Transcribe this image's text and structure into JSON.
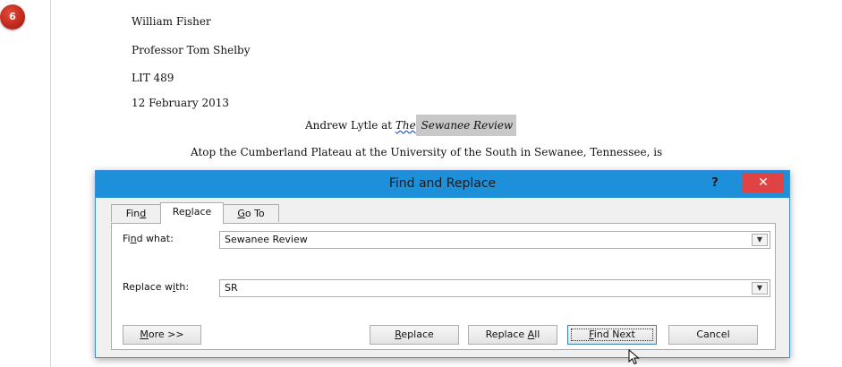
{
  "step_badge": "6",
  "document": {
    "lines": [
      "William Fisher",
      "Professor Tom Shelby",
      "LIT 489",
      "12 February 2013"
    ],
    "title_prefix": "Andrew Lytle at ",
    "title_the": "The",
    "title_highlight": " Sewanee Review",
    "paragraph": "Atop the Cumberland Plateau at the University of the South in Sewanee, Tennessee, is"
  },
  "dialog": {
    "title": "Find and Replace",
    "help": "?",
    "close": "✕",
    "tabs": {
      "find": {
        "pre": "Fin",
        "acc": "d",
        "post": ""
      },
      "replace": {
        "pre": "Re",
        "acc": "p",
        "post": "lace"
      },
      "goto": {
        "pre": "",
        "acc": "G",
        "post": "o To"
      },
      "active": "Replace"
    },
    "find_what": {
      "label_pre": "Fi",
      "label_acc": "n",
      "label_post": "d what:",
      "value": "Sewanee Review"
    },
    "replace_with": {
      "label_pre": "Replace w",
      "label_acc": "i",
      "label_post": "th:",
      "value": "SR"
    },
    "buttons": {
      "more": {
        "pre": "",
        "acc": "M",
        "post": "ore >>"
      },
      "replace": {
        "pre": "",
        "acc": "R",
        "post": "eplace"
      },
      "replace_all": {
        "pre": "Replace ",
        "acc": "A",
        "post": "ll"
      },
      "find_next": {
        "pre": "",
        "acc": "F",
        "post": "ind Next"
      },
      "cancel": {
        "pre": "Cancel",
        "acc": "",
        "post": ""
      }
    },
    "colors": {
      "titlebar": "#1e90d9",
      "close": "#e04343",
      "badge": "#c0281c"
    }
  }
}
